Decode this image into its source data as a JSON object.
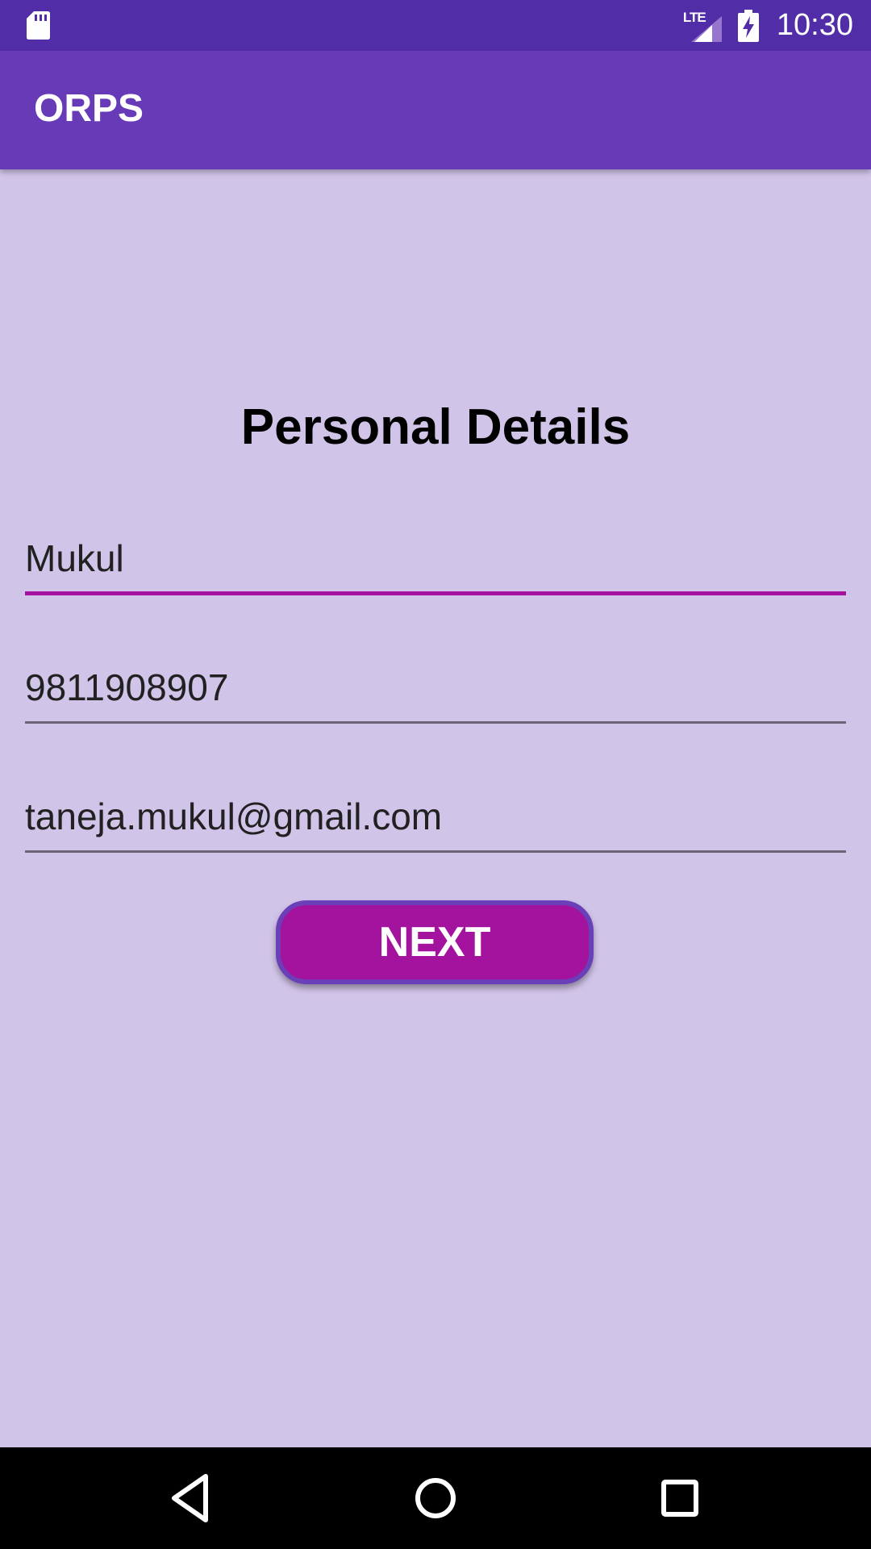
{
  "status_bar": {
    "time": "10:30",
    "network_label": "LTE",
    "icons": [
      "sd-card-icon",
      "signal-icon",
      "battery-charging-icon"
    ]
  },
  "app_bar": {
    "title": "ORPS",
    "color": "#673ab7"
  },
  "form": {
    "heading": "Personal Details",
    "fields": [
      {
        "name": "name",
        "value": "Mukul",
        "focused": true
      },
      {
        "name": "phone",
        "value": "9811908907",
        "focused": false
      },
      {
        "name": "email",
        "value": "taneja.mukul@gmail.com",
        "focused": false
      }
    ],
    "next_label": "NEXT"
  },
  "nav_bar": {
    "icons": [
      "back-icon",
      "home-icon",
      "recents-icon"
    ]
  },
  "colors": {
    "status_bar": "#512da8",
    "background": "#d1c4e9",
    "accent": "#a3139e",
    "button_border": "#6a3fb8"
  }
}
